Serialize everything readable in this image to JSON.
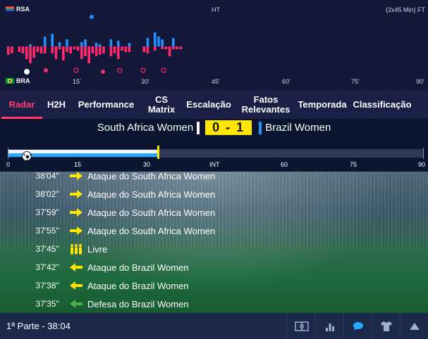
{
  "momentum": {
    "home_team": "RSA",
    "away_team": "BRA",
    "ht_label": "HT",
    "ft_label": "(2x45 Min) FT",
    "minute_labels": [
      "15'",
      "30'",
      "45'",
      "60'",
      "75'",
      "90'"
    ],
    "colors": {
      "home": "#ff2a6d",
      "away": "#1e90ff"
    }
  },
  "tabs": [
    {
      "label": "Radar",
      "active": true
    },
    {
      "label": "H2H"
    },
    {
      "label": "Performance"
    },
    {
      "label": "CS Matrix"
    },
    {
      "label": "Escalação"
    },
    {
      "label": "Fatos Relevantes"
    },
    {
      "label": "Temporada"
    },
    {
      "label": "Classificação"
    }
  ],
  "score": {
    "home": "South Africa Women",
    "result": "0 - 1",
    "away": "Brazil Women"
  },
  "timeline": {
    "ticks": [
      "0",
      "15",
      "30",
      "INT",
      "60",
      "75",
      "90"
    ],
    "elapsed_minutes": 38.07
  },
  "events": [
    {
      "time": "38'04''",
      "text": "Ataque do South Africa Women",
      "icon": "arrow-right-icon",
      "color": "#ffe600"
    },
    {
      "time": "38'02''",
      "text": "Ataque do South Africa Women",
      "icon": "arrow-right-icon",
      "color": "#ffe600"
    },
    {
      "time": "37'59''",
      "text": "Ataque do South Africa Women",
      "icon": "arrow-right-icon",
      "color": "#ffe600"
    },
    {
      "time": "37'55''",
      "text": "Ataque do South Africa Women",
      "icon": "arrow-right-icon",
      "color": "#ffe600"
    },
    {
      "time": "37'45''",
      "text": "Livre",
      "icon": "players-icon",
      "color": "#ffe600"
    },
    {
      "time": "37'42''",
      "text": "Ataque do Brazil Women",
      "icon": "arrow-left-icon",
      "color": "#ffe600"
    },
    {
      "time": "37'38''",
      "text": "Ataque do Brazil Women",
      "icon": "arrow-left-icon",
      "color": "#ffe600"
    },
    {
      "time": "37'35''",
      "text": "Defesa do Brazil Women",
      "icon": "arrow-left-icon",
      "color": "#4caf50"
    }
  ],
  "bottom": {
    "period": "1ª Parte - 38:04",
    "buttons": [
      "pitch-icon",
      "stats-icon",
      "chat-icon",
      "shirt-icon",
      "up-arrow-icon"
    ]
  }
}
